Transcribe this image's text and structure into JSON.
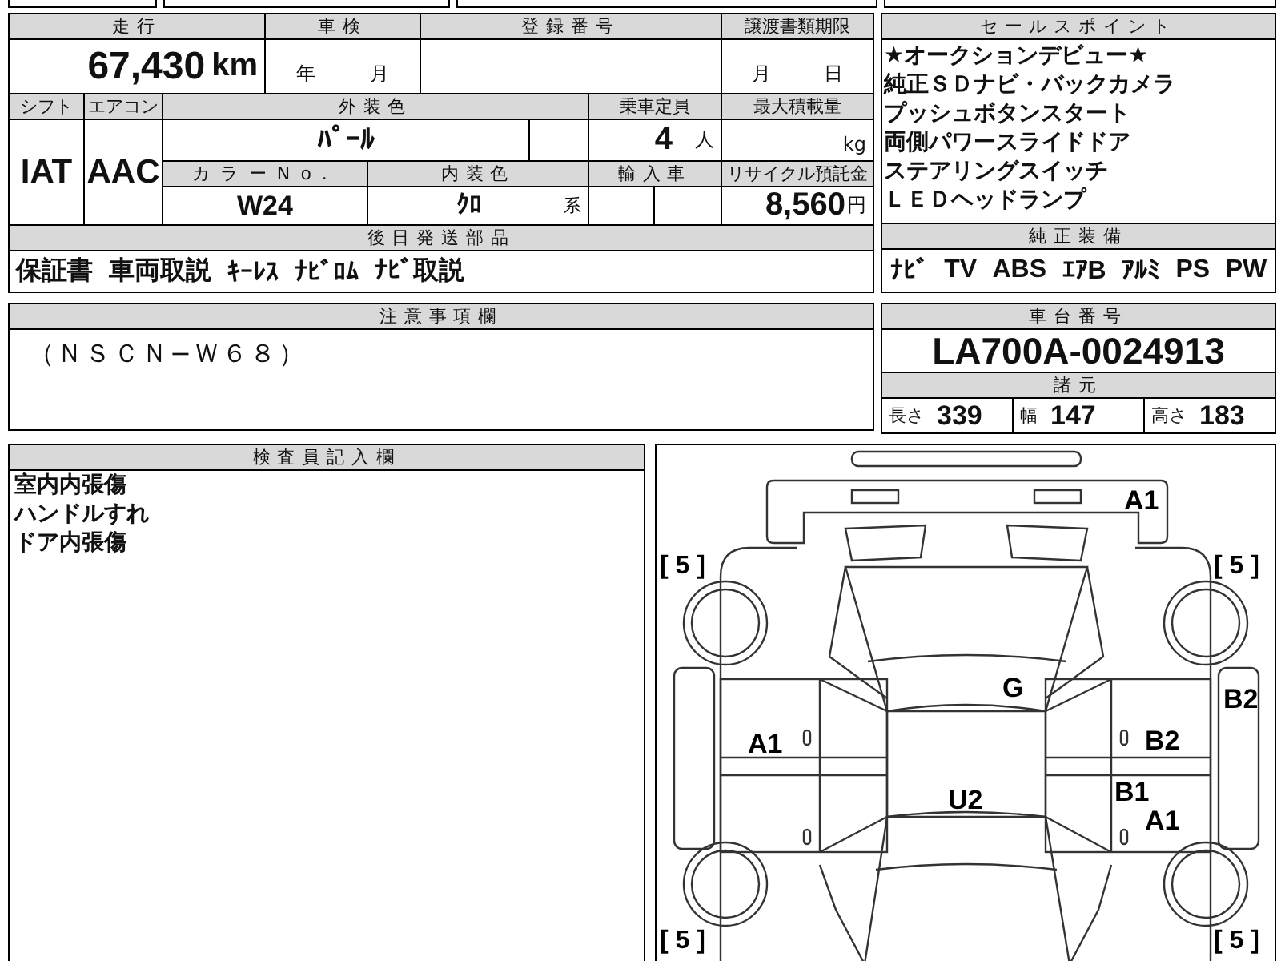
{
  "mileage": {
    "label": "走行",
    "value": "67,430",
    "unit": "km"
  },
  "inspection": {
    "label": "車検",
    "year_unit": "年",
    "month_unit": "月"
  },
  "registration": {
    "label": "登録番号"
  },
  "transfer_deadline": {
    "label": "譲渡書類期限",
    "month_unit": "月",
    "day_unit": "日"
  },
  "shift": {
    "label": "シフト",
    "value": "IAT"
  },
  "aircon": {
    "label": "エアコン",
    "value": "AAC"
  },
  "exterior_color": {
    "label": "外装色",
    "value": "ﾊﾟｰﾙ"
  },
  "capacity": {
    "label": "乗車定員",
    "value": "4",
    "unit": "人"
  },
  "max_load": {
    "label": "最大積載量",
    "unit": "kg"
  },
  "color_no": {
    "label": "カラーNo.",
    "value": "W24"
  },
  "interior_color": {
    "label": "内装色",
    "value": "ｸﾛ",
    "unit": "系"
  },
  "import": {
    "label": "輸入車"
  },
  "recycle_fee": {
    "label": "リサイクル預託金",
    "value": "8,560",
    "unit": "円"
  },
  "parts_later": {
    "label": "後日発送部品",
    "items": [
      "保証書",
      "車両取説",
      "ｷｰﾚｽ",
      "ﾅﾋﾞﾛﾑ",
      "ﾅﾋﾞ取説"
    ]
  },
  "sales_points": {
    "label": "セールスポイント",
    "lines": [
      "★オークションデビュー★",
      "純正ＳＤナビ・バックカメラ",
      "プッシュボタンスタート",
      "両側パワースライドドア",
      "ステアリングスイッチ",
      "ＬＥＤヘッドランプ"
    ]
  },
  "equipment": {
    "label": "純正装備",
    "items": [
      "ﾅﾋﾞ",
      "TV",
      "ABS",
      "ｴｱB",
      "ｱﾙﾐ",
      "PS",
      "PW"
    ]
  },
  "notes": {
    "label": "注意事項欄",
    "text": "（ＮＳＣＮ−Ｗ６８）"
  },
  "chassis": {
    "label": "車台番号",
    "value": "LA700A-0024913"
  },
  "specs": {
    "label": "諸元",
    "items": [
      {
        "label": "長さ",
        "value": "339"
      },
      {
        "label": "幅",
        "value": "147"
      },
      {
        "label": "高さ",
        "value": "183"
      }
    ]
  },
  "inspector": {
    "label": "検査員記入欄",
    "lines": [
      "室内内張傷",
      "ハンドルすれ",
      "ドア内張傷"
    ]
  },
  "diagram": {
    "tire_marks": [
      "[ 5 ]",
      "[ 5 ]",
      "[ 5 ]",
      "[ 5 ]"
    ],
    "damage_marks": [
      {
        "label": "A1"
      },
      {
        "label": "G"
      },
      {
        "label": "B2"
      },
      {
        "label": "A1"
      },
      {
        "label": "B2"
      },
      {
        "label": "B1"
      },
      {
        "label": "A1"
      },
      {
        "label": "U2"
      }
    ]
  }
}
